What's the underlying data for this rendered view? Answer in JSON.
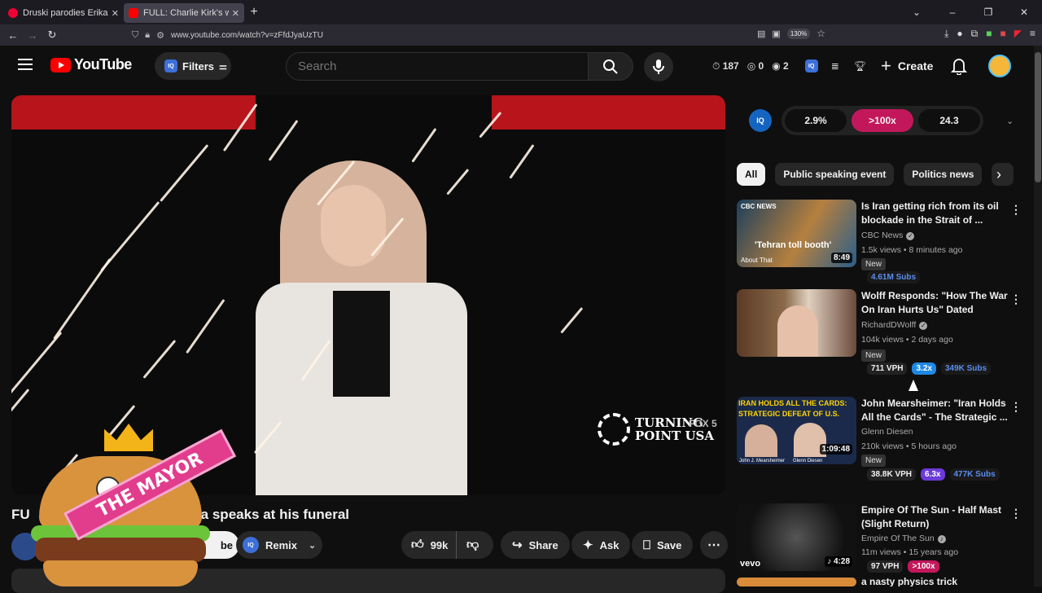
{
  "browser": {
    "tabs": [
      {
        "title": "Druski parodies Erika Kirk in a ne",
        "active": false
      },
      {
        "title": "FULL: Charlie Kirk's widow Erika",
        "active": true
      }
    ],
    "url": "www.youtube.com/watch?v=zFfdJyaUzTU",
    "zoom": "130%",
    "window_controls": [
      "⌄",
      "–",
      "❐",
      "✕"
    ]
  },
  "header": {
    "logo_text": "YouTube",
    "filters_label": "Filters",
    "search_placeholder": "Search",
    "stats": {
      "time": "187",
      "zero": "0",
      "eye": "2"
    },
    "create_label": "Create"
  },
  "player": {
    "watermark": "TURNING\nPOINT USA",
    "watermark_line1": "TURNING",
    "watermark_line2": "POINT USA",
    "network": "FOX 5"
  },
  "video": {
    "title_visible": "FU",
    "title_tail": "a speaks at his funeral",
    "subscribe_label": "be",
    "remix_label": "Remix",
    "likes": "99k",
    "share_label": "Share",
    "ask_label": "Ask",
    "save_label": "Save",
    "channel_badge": "5"
  },
  "overlay": {
    "sash_text": "THE MAYOR"
  },
  "iq_panel": {
    "metrics": [
      "2.9%",
      ">100x",
      "24.3"
    ]
  },
  "chips": [
    "All",
    "Public speaking event",
    "Politics news"
  ],
  "recommendations": [
    {
      "title": "Is Iran getting rich from its oil blockade in the Strait of ...",
      "channel": "CBC News",
      "verified": true,
      "meta": "1.5k views • 8 minutes ago",
      "duration": "8:49",
      "thumb_caption": "'Tehran toll booth'",
      "thumb_logo": "CBC NEWS",
      "thumb_sub": "About That",
      "new": "New",
      "tags": [
        {
          "text": "4.61M Subs",
          "kind": "subs"
        }
      ]
    },
    {
      "title": "Wolff Responds: \"How The War On Iran Hurts Us\" Dated March...",
      "channel": "RichardDWolff",
      "verified": true,
      "meta": "104k views • 2 days ago",
      "duration": "",
      "new": "New",
      "tags": [
        {
          "text": "711 VPH",
          "kind": "plain"
        },
        {
          "text": "3.2x",
          "kind": "blue"
        },
        {
          "text": "349K Subs",
          "kind": "subs"
        }
      ]
    },
    {
      "title": "John Mearsheimer: \"Iran Holds All the Cards\" - The Strategic ...",
      "channel": "Glenn Diesen",
      "verified": false,
      "meta": "210k views • 5 hours ago",
      "duration": "1:09:48",
      "thumb_caption": "IRAN HOLDS ALL THE CARDS:",
      "thumb_caption2": "STRATEGIC DEFEAT OF U.S.",
      "thumb_names": "John J. Mearsheimer      Glenn Diesen",
      "new": "New",
      "tags": [
        {
          "text": "38.8K VPH",
          "kind": "plain"
        },
        {
          "text": "6.3x",
          "kind": "purple"
        },
        {
          "text": "477K Subs",
          "kind": "subs"
        }
      ]
    },
    {
      "title": "Empire Of The Sun - Half Mast (Slight Return)",
      "channel": "Empire Of The Sun",
      "verified": true,
      "meta": "11m views • 15 years ago",
      "duration": "4:28",
      "thumb_logo": "vevo",
      "tags": [
        {
          "text": "97 VPH",
          "kind": "plain"
        },
        {
          "text": ">100x",
          "kind": "pink"
        }
      ]
    },
    {
      "title": "a nasty physics trick",
      "channel": "",
      "meta": ""
    }
  ]
}
